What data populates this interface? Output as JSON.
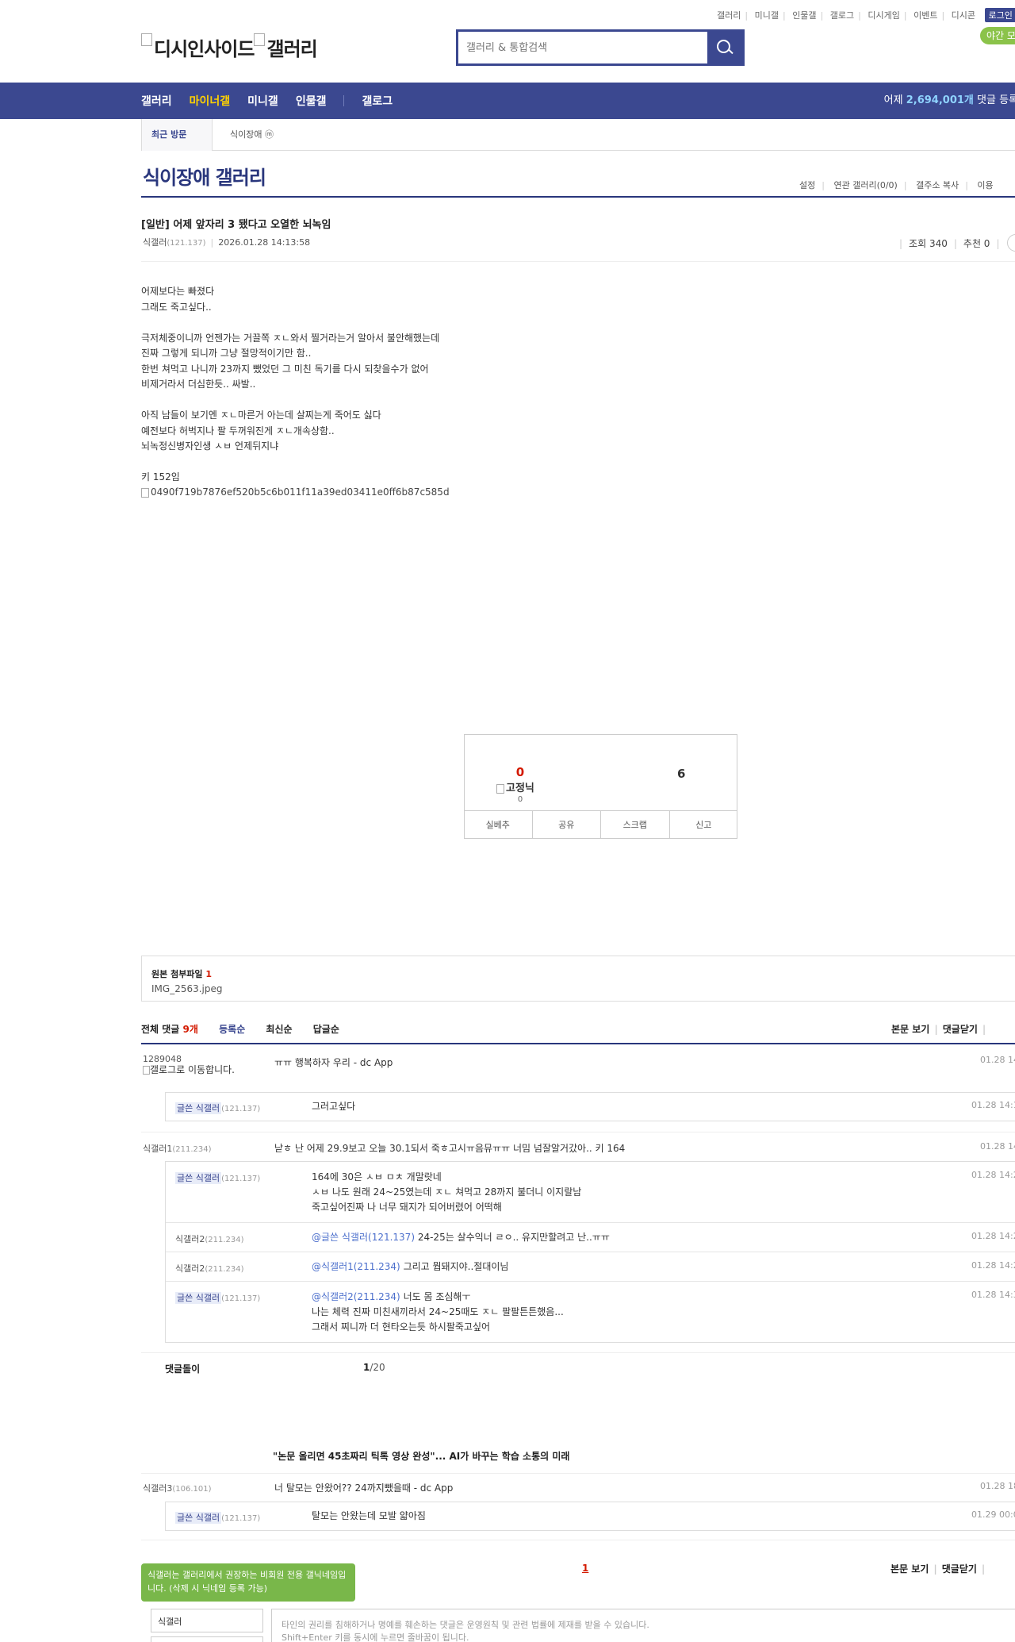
{
  "util": {
    "links": [
      "갤러리",
      "미니갤",
      "인물갤",
      "갤로그",
      "디시게임",
      "이벤트",
      "디시콘"
    ],
    "login": "로그인",
    "night": "야간 모"
  },
  "logo": {
    "alt1": "디시인사이드",
    "alt2": "갤러리"
  },
  "search": {
    "placeholder": "갤러리 & 통합검색"
  },
  "nav": {
    "items": [
      "갤러리",
      "마이너갤",
      "미니갤",
      "인물갤",
      "갤로그"
    ],
    "stat_prefix": "어제 ",
    "stat_num": "2,694,001개",
    "stat_suffix": " 댓글 등록"
  },
  "recent": {
    "label": "최근 방문",
    "item": "식이장애 ⓜ"
  },
  "gallery": {
    "title": "식이장애 갤러리",
    "opts": [
      "설정",
      "연관 갤러리(0/0)",
      "갤주소 복사",
      "이용"
    ]
  },
  "post": {
    "title": "[일반] 어제 앞자리 3 됐다고 오열한 뇌녹임",
    "author": "식갤러",
    "ip": "(121.137)",
    "date": "2026.01.28 14:13:58",
    "views": "조회 340",
    "recommends": "추천 0",
    "lines": [
      "어제보다는 빠졌다",
      "그래도 죽고싶다..",
      "",
      "극저체중이니까 언젠가는 거끌쪽 ㅈㄴ와서 찔거라는거 알아서 불안해했는데",
      "진짜 그렇게 되니까 그냥 절망적이기만 함..",
      "한번 쳐먹고 나니까 23까지 뺐었던 그 미친 독기를 다시 되찾을수가 없어",
      "비제거라서 더심한듯.. 싸발..",
      "",
      "아직 남들이 보기엔 ㅈㄴ마른거 아는데 살찌는게 죽어도 싫다",
      "예전보다 허벅지나 팔 두꺼워진게 ㅈㄴ개속상함..",
      "뇌녹정신병자인생 ㅅㅂ 언제뒤지냐",
      "",
      "키 152임"
    ],
    "image_alt": "0490f719b7876ef520b5c6b011f11a39ed03411e0ff6b87c585d"
  },
  "recommend": {
    "up": "0",
    "fix_alt": "고정닉",
    "fix_count": "0",
    "down": "6",
    "buttons": [
      "실베추",
      "공유",
      "스크랩",
      "신고"
    ]
  },
  "attach": {
    "label": "원본 첨부파일",
    "count": "1",
    "file": "IMG_2563.jpeg"
  },
  "comments_head": {
    "total_label": "전체 댓글",
    "total": "9개",
    "tabs": [
      "등록순",
      "최신순",
      "답글순"
    ],
    "right": [
      "본문 보기",
      "댓글닫기"
    ]
  },
  "comments": [
    {
      "nick": "1289048",
      "img_alt": "갤로그로 이동합니다.",
      "text": "ㅠㅠ 행복하자 우리 - dc App",
      "date": "01.28 14"
    },
    {
      "nick": "식갤러1",
      "ip": "(211.234)",
      "text": "낟ㅎ 난 어제 29.9보고 오늘 30.1되서 죽ㅎ고시ㅠ음뮤ㅠㅠ 너밈 넘잘알거갔아.. 키 164",
      "date": "01.28 14"
    },
    {
      "nick": "식갤러3",
      "ip": "(106.101)",
      "text": "너 탈모는 안왔어?? 24까지뺐을때 - dc App",
      "date": "01.28 18"
    }
  ],
  "replies1": [
    {
      "nick": "글쓴 식갤러",
      "ip": "(121.137)",
      "text": "그러고싶다",
      "date": "01.28 14:1"
    }
  ],
  "replies2": [
    {
      "nick": "글쓴 식갤러",
      "ip": "(121.137)",
      "l1": "164에 30은 ㅅㅂ ㅁㅊ 개말랏네",
      "l2": "ㅅㅂ 나도 원래 24~25였는데 ㅈㄴ 쳐먹고 28까지 불더니 이지랄남",
      "l3": "죽고싶어진짜 나 너무 돼지가 되어버렸어 어떡해",
      "date": "01.28 14:2"
    },
    {
      "nick": "식갤러2",
      "ip": "(211.234)",
      "mention": "@글쓴 식갤러(121.137)",
      "text": " 24-25는 살수익너 ㄹㅇ.. 유지만할려고 난..ㅠㅠ",
      "date": "01.28 14:2"
    },
    {
      "nick": "식갤러2",
      "ip": "(211.234)",
      "mention": "@식갤러1(211.234)",
      "text": " 그리고 뭡돼지야..절대이님",
      "date": "01.28 14:2"
    },
    {
      "nick": "글쓴 식갤러",
      "ip": "(121.137)",
      "mention": "@식갤러2(211.234)",
      "l1": " 너도 몸 조심해ㅜ",
      "l2": "나는 체력 진짜 미친새끼라서 24~25때도 ㅈㄴ 팔팔튼튼했음...",
      "l3": "그래서 찌니까 더 현타오는듯 하시팔죽고싶어",
      "date": "01.28 14:3"
    }
  ],
  "comment_page": {
    "label": "댓글돌이",
    "num": "1",
    "total": "/20"
  },
  "ad": "\"논문 올리면 45초짜리 틱톡 영상 완성\"... AI가 바꾸는 학습 소통의 미래",
  "replies3": [
    {
      "nick": "글쓴 식갤러",
      "ip": "(121.137)",
      "text": "탈모는 안왔는데 모발 얇아짐",
      "date": "01.29 00:0"
    }
  ],
  "pager": {
    "page": "1",
    "right": [
      "본문 보기",
      "댓글닫기"
    ]
  },
  "write": {
    "tip": "식갤러는 갤러리에서 권장하는 비회원 전용 갤닉네임입니다. (삭제 시 닉네임 등록 가능)",
    "nick": "식갤러",
    "notice1": "타인의 권리를 침해하거나 명예를 훼손하는 댓글은 운영원칙 및 관련 법률에 제재를 받을 수 있습니다.",
    "notice2": "Shift+Enter 키를 동시에 누르면 줄바꿈이 됩니다."
  }
}
